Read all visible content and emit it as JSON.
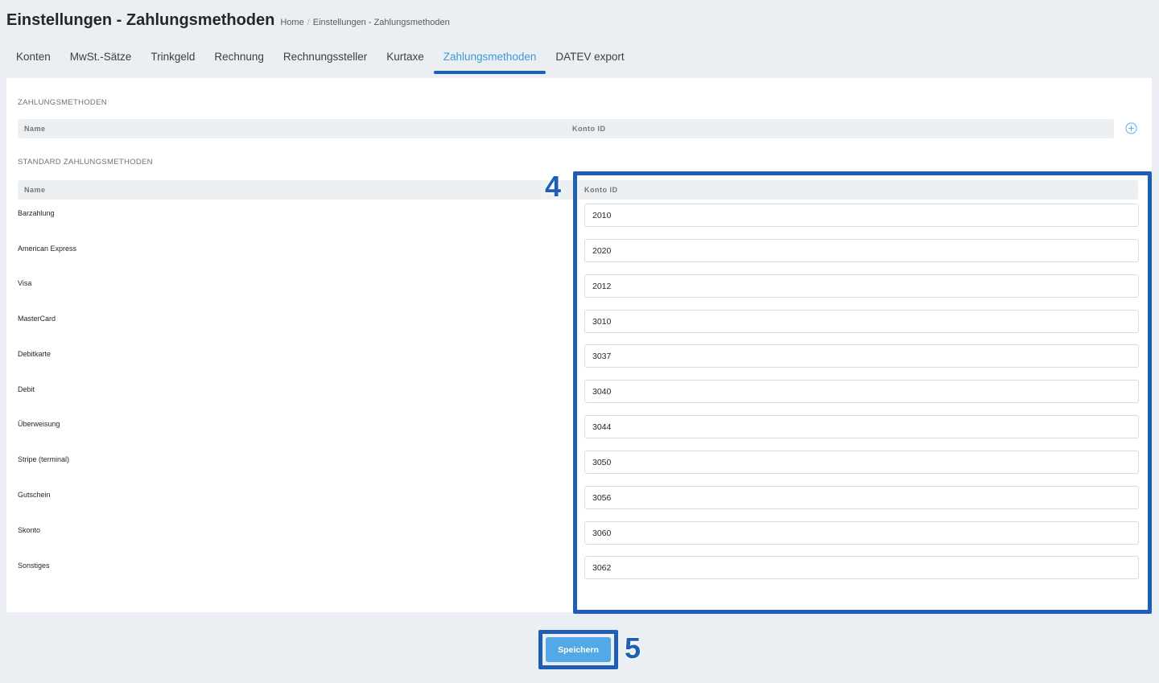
{
  "header": {
    "title": "Einstellungen - Zahlungsmethoden",
    "breadcrumb": [
      "Home",
      "Einstellungen - Zahlungsmethoden"
    ]
  },
  "tabs": [
    {
      "label": "Konten",
      "active": false
    },
    {
      "label": "MwSt.-Sätze",
      "active": false
    },
    {
      "label": "Trinkgeld",
      "active": false
    },
    {
      "label": "Rechnung",
      "active": false
    },
    {
      "label": "Rechnungssteller",
      "active": false
    },
    {
      "label": "Kurtaxe",
      "active": false
    },
    {
      "label": "Zahlungsmethoden",
      "active": true
    },
    {
      "label": "DATEV export",
      "active": false
    }
  ],
  "custom_section": {
    "title": "ZAHLUNGSMETHODEN",
    "col_name": "Name",
    "col_konto": "Konto ID",
    "add_icon": "plus-circle-icon"
  },
  "standard_section": {
    "title": "STANDARD ZAHLUNGSMETHODEN",
    "col_name": "Name",
    "col_konto": "Konto ID",
    "rows": [
      {
        "name": "Barzahlung",
        "konto_id": "2010"
      },
      {
        "name": "American Express",
        "konto_id": "2020"
      },
      {
        "name": "Visa",
        "konto_id": "2012"
      },
      {
        "name": "MasterCard",
        "konto_id": "3010"
      },
      {
        "name": "Debitkarte",
        "konto_id": "3037"
      },
      {
        "name": "Debit",
        "konto_id": "3040"
      },
      {
        "name": "Überweisung",
        "konto_id": "3044"
      },
      {
        "name": "Stripe (terminal)",
        "konto_id": "3050"
      },
      {
        "name": "Gutschein",
        "konto_id": "3056"
      },
      {
        "name": "Skonto",
        "konto_id": "3060"
      },
      {
        "name": "Sonstiges",
        "konto_id": "3062"
      }
    ]
  },
  "save_label": "Speichern",
  "annotations": {
    "callout_4": "4",
    "callout_5": "5"
  },
  "colors": {
    "accent": "#3b9ad9",
    "annotation": "#1e5eb5",
    "button": "#53a9e5"
  }
}
